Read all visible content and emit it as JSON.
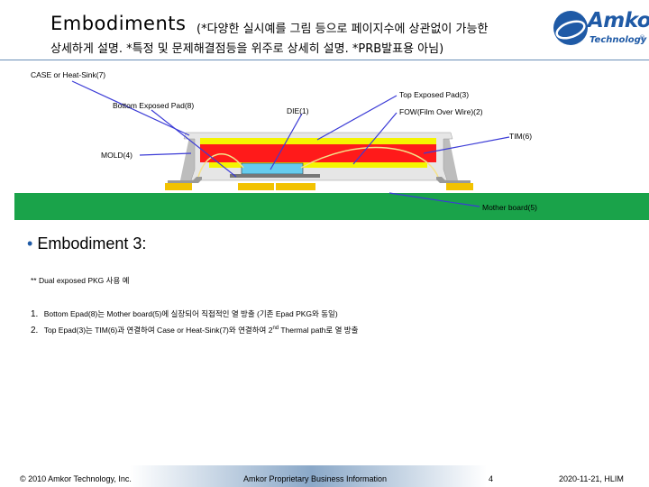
{
  "header": {
    "title": "Embodiments",
    "title_note": "(*다양한 실시예를 그림 등으로 페이지수에 상관없이 가능한",
    "line2": "상세하게 설명. *특정 및 문제해결점등을 위주로 상세히 설명.  *PRB발표용 아님)"
  },
  "logo": {
    "word": "Amkor",
    "sub": "Technology",
    "reg": "®"
  },
  "diagram": {
    "labels": {
      "case": "CASE or Heat-Sink(7)",
      "bottom_pad": "Bottom Exposed Pad(8)",
      "die": "DIE(1)",
      "top_pad": "Top Exposed  Pad(3)",
      "fow": "FOW(Film Over Wire)(2)",
      "tim": "TIM(6)",
      "mold": "MOLD(4)",
      "mother_board": "Mother board(5)"
    },
    "colors": {
      "case": "#e8e8e8",
      "fow": "#f5f500",
      "tim": "#ff0000",
      "mold": "#bdbdbd",
      "die": "#66ccee",
      "board": "#1aa34a",
      "pad": "#f2c200",
      "arrow": "#3b3bd6"
    }
  },
  "content": {
    "bullet_heading": "Embodiment 3:",
    "note": "** Dual exposed PKG 사용 예",
    "items": [
      {
        "num": "1.",
        "text": "Bottom Epad(8)는 Mother board(5)에 실장되어 직접적인 열 방출 (기존 Epad PKG와 동일)"
      },
      {
        "num": "2.",
        "text_a": "Top Epad(3)는 TIM(6)과 연결하여 Case or Heat-Sink(7)와 연결하여 2",
        "sup": "nd",
        "text_b": " Thermal path로 열 방출"
      }
    ]
  },
  "footer": {
    "copyright": "© 2010 Amkor Technology, Inc.",
    "center": "Amkor Proprietary Business Information",
    "page": "4",
    "right": "2020-11-21, HLIM"
  }
}
